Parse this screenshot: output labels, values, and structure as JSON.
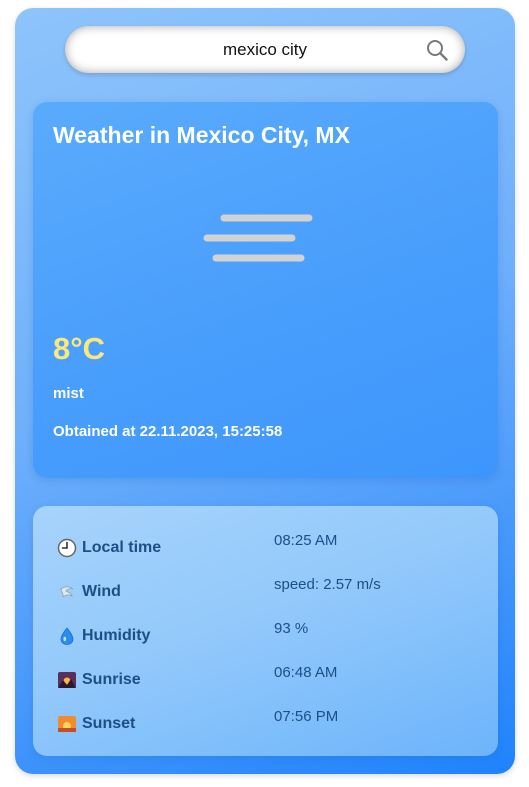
{
  "search": {
    "value": "mexico city",
    "icon": "search-icon"
  },
  "weather": {
    "title": "Weather in Mexico City, MX",
    "icon": "mist-icon",
    "temperature": "8°C",
    "description": "mist",
    "obtained": "Obtained at 22.11.2023, 15:25:58"
  },
  "details": [
    {
      "label": "Local time",
      "value": "08:25 AM",
      "icon": "clock-icon"
    },
    {
      "label": "Wind",
      "value": "speed: 2.57 m/s",
      "icon": "wind-icon"
    },
    {
      "label": "Humidity",
      "value": "93 %",
      "icon": "droplet-icon"
    },
    {
      "label": "Sunrise",
      "value": "06:48 AM",
      "icon": "sunrise-icon"
    },
    {
      "label": "Sunset",
      "value": "07:56 PM",
      "icon": "sunset-icon"
    }
  ],
  "colors": {
    "temperature": "#fbe77a",
    "detail_text": "#1d4f86"
  }
}
